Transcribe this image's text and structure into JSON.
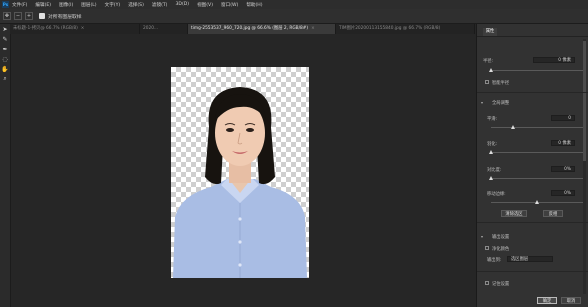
{
  "app": {
    "logo": "Ps"
  },
  "menu": [
    "文件(F)",
    "编辑(E)",
    "图像(I)",
    "图层(L)",
    "文字(Y)",
    "选择(S)",
    "滤镜(T)",
    "3D(D)",
    "视图(V)",
    "窗口(W)",
    "帮助(H)"
  ],
  "options": {
    "label": "对所有图层取样",
    "checked": true,
    "icons": [
      "move-icon",
      "subtract-icon",
      "add-icon"
    ]
  },
  "tabs": [
    {
      "label": "未标题-1-拷贝@ 66.7% (RGB/8)",
      "active": false
    },
    {
      "label": "2020...",
      "active": false
    },
    {
      "label": "timg-2553537_960_720.jpg @ 66.6% (图层 2, RGB/8#)",
      "active": true
    },
    {
      "label": "TIM图片20200113155840.jpg @ 66.7% (RGB/8)",
      "active": false
    }
  ],
  "tools": [
    "arrow-icon",
    "brush-icon",
    "pen-icon",
    "lasso-icon",
    "hand-icon",
    "zoom-icon"
  ],
  "panel": {
    "tab": "属性",
    "radius_label": "半径:",
    "radius_value": "0 像素",
    "smart_radius": "智能半径",
    "global_adjust": "全局调整",
    "smooth_label": "平滑:",
    "smooth_value": "0",
    "feather_label": "羽化:",
    "feather_value": "0 像素",
    "contrast_label": "对比度:",
    "contrast_value": "0%",
    "shift_label": "移动边缘:",
    "shift_value": "0%",
    "clear_button": "清除选区",
    "invert_button": "反相",
    "output_settings": "输出设置",
    "decontaminate": "净化颜色",
    "output_to_label": "输出到:",
    "output_to_value": "选区图层",
    "remember": "记住设置",
    "ok_button": "确定",
    "cancel_button": "取消"
  }
}
